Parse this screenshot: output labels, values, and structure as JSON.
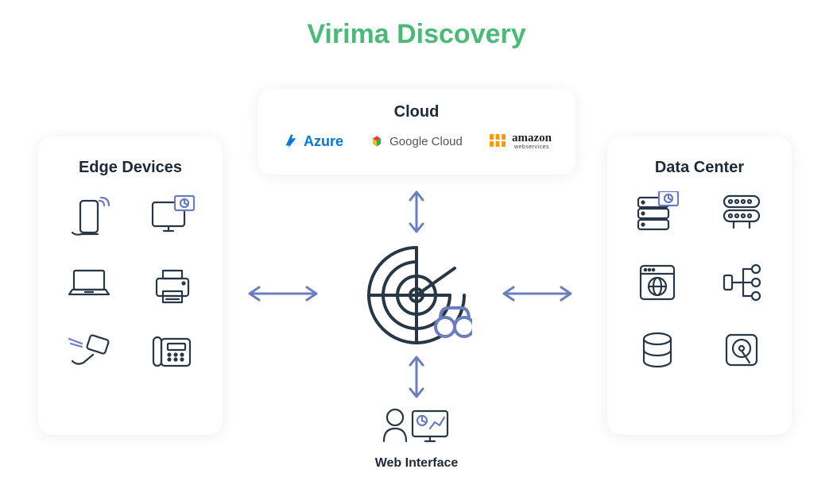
{
  "title": "Virima Discovery",
  "panels": {
    "cloud": {
      "title": "Cloud",
      "providers": {
        "azure": "Azure",
        "gcp": "Google Cloud",
        "aws_top": "amazon",
        "aws_bottom": "webservices"
      }
    },
    "edge": {
      "title": "Edge Devices",
      "devices": [
        "mobile-phone",
        "desktop-monitor",
        "laptop",
        "printer",
        "barcode-scanner",
        "office-phone"
      ]
    },
    "datacenter": {
      "title": "Data Center",
      "items": [
        "server-stack",
        "server-rack",
        "web-app",
        "network-topology",
        "database",
        "storage-disk"
      ]
    }
  },
  "center": {
    "label": "Discovery Radar"
  },
  "web_interface": {
    "label": "Web Interface"
  },
  "colors": {
    "accent": "#4BB977",
    "arrow": "#6B7DBF",
    "line": "#283746",
    "azure": "#0078D4",
    "aws": "#FF9900"
  }
}
